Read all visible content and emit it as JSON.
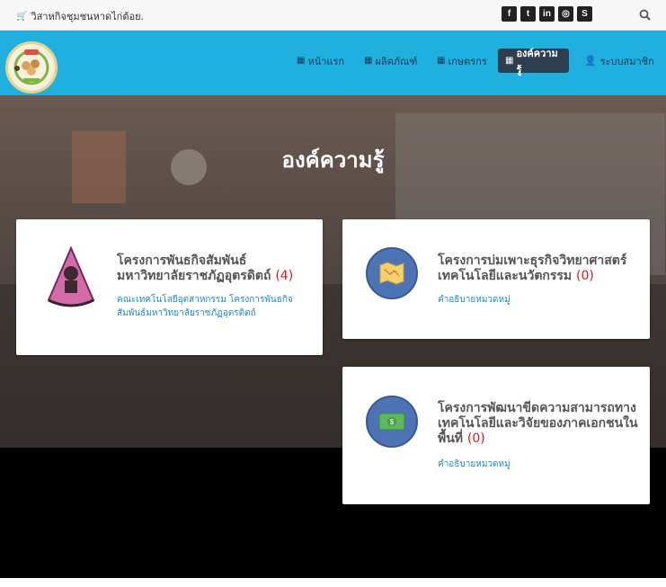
{
  "topbar": {
    "site_name": "วิสาหกิจชุมชนหาดไก่ต้อย.",
    "social_icons": [
      "facebook-icon",
      "twitter-icon",
      "linkedin-icon",
      "dribbble-icon",
      "skype-icon"
    ]
  },
  "nav": {
    "items": [
      {
        "label": "หน้าแรก",
        "icon": "grid-icon",
        "active": false
      },
      {
        "label": "ผลิตภัณฑ์",
        "icon": "grid-icon",
        "active": false
      },
      {
        "label": "เกษตรกร",
        "icon": "grid-icon",
        "active": false
      },
      {
        "label": "องค์ความรู้",
        "icon": "grid-icon",
        "active": true
      },
      {
        "label": "ระบบสมาชิก",
        "icon": "user-icon",
        "active": false
      }
    ]
  },
  "hero": {
    "title": "องค์ความรู้"
  },
  "cards": [
    {
      "title": "โครงการพันธกิจสัมพันธ์มหาวิทยาลัยราชภัฏอุตรดิตถ์",
      "count": "(4)",
      "description": "คณะเทคโนโลยีอุตสาหกรรม โครงการพันธกิจสัมพันธ์มหาวิทยาลัยราชภัฏอุตรดิตถ์",
      "icon": "university-logo"
    },
    {
      "title": "โครงการบ่มเพาะธุรกิจวิทยาศาสตร์ เทคโนโลยีและนวัตกรรม",
      "count": "(0)",
      "description": "คำอธิบายหมวดหมู่",
      "icon": "map-icon"
    },
    {
      "title": "โครงการพัฒนาขีดความสามารถทางเทคโนโลยีและวิจัยของภาคเอกชนในพื้นที่",
      "count": "(0)",
      "description": "คำอธิบายหมวดหมู่",
      "icon": "money-icon"
    }
  ],
  "colors": {
    "navbar": "#1fb0e0",
    "active_nav": "#2d3e50",
    "count_red": "#e0161d",
    "link_blue": "#1f8bc4",
    "icon_circle": "#4e73b4"
  }
}
